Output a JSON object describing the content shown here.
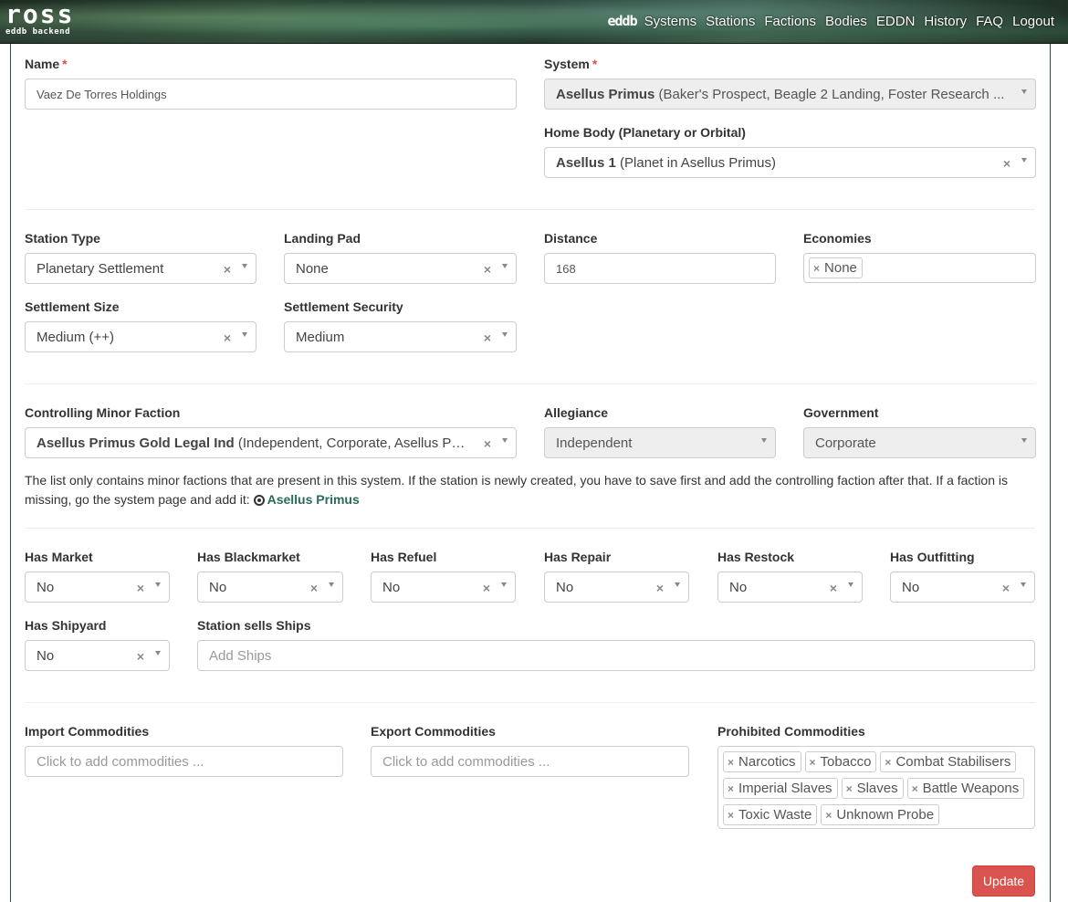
{
  "logo": {
    "big": "ross",
    "small": "eddb backend"
  },
  "nav": {
    "brand": "eddb",
    "items": [
      "Systems",
      "Stations",
      "Factions",
      "Bodies",
      "EDDN",
      "History",
      "FAQ",
      "Logout"
    ]
  },
  "form": {
    "name": {
      "label": "Name",
      "required": "*",
      "value": "Vaez De Torres Holdings"
    },
    "system": {
      "label": "System",
      "required": "*",
      "value_bold": "Asellus Primus",
      "value_rest": " (Baker's Prospect, Beagle 2 Landing, Foster Research ..."
    },
    "home_body": {
      "label": "Home Body (Planetary or Orbital)",
      "value_bold": "Asellus 1",
      "value_rest": " (Planet in Asellus Primus)"
    },
    "station_type": {
      "label": "Station Type",
      "value": "Planetary Settlement"
    },
    "landing_pad": {
      "label": "Landing Pad",
      "value": "None"
    },
    "distance": {
      "label": "Distance",
      "value": "168"
    },
    "economies": {
      "label": "Economies",
      "tags": [
        "None"
      ]
    },
    "settlement_size": {
      "label": "Settlement Size",
      "value": "Medium (++)"
    },
    "settlement_security": {
      "label": "Settlement Security",
      "value": "Medium"
    },
    "controlling_faction": {
      "label": "Controlling Minor Faction",
      "value_bold": "Asellus Primus Gold Legal Ind",
      "value_rest": " (Independent, Corporate, Asellus Pri..."
    },
    "allegiance": {
      "label": "Allegiance",
      "value": "Independent"
    },
    "government": {
      "label": "Government",
      "value": "Corporate"
    },
    "help": {
      "text": "The list only contains minor factions that are present in this system. If the station is newly created, you have to save first and add the controlling faction after that. If a faction is missing, go the system page and add it:",
      "link": "Asellus Primus"
    },
    "has_market": {
      "label": "Has Market",
      "value": "No"
    },
    "has_blackmarket": {
      "label": "Has Blackmarket",
      "value": "No"
    },
    "has_refuel": {
      "label": "Has Refuel",
      "value": "No"
    },
    "has_repair": {
      "label": "Has Repair",
      "value": "No"
    },
    "has_restock": {
      "label": "Has Restock",
      "value": "No"
    },
    "has_outfitting": {
      "label": "Has Outfitting",
      "value": "No"
    },
    "has_shipyard": {
      "label": "Has Shipyard",
      "value": "No"
    },
    "station_ships": {
      "label": "Station sells Ships",
      "placeholder": "Add Ships"
    },
    "import_commodities": {
      "label": "Import Commodities",
      "placeholder": "Click to add commodities ..."
    },
    "export_commodities": {
      "label": "Export Commodities",
      "placeholder": "Click to add commodities ..."
    },
    "prohibited": {
      "label": "Prohibited Commodities",
      "tags": [
        "Narcotics",
        "Tobacco",
        "Combat Stabilisers",
        "Imperial Slaves",
        "Slaves",
        "Battle Weapons",
        "Toxic Waste",
        "Unknown Probe"
      ]
    },
    "update_label": "Update"
  },
  "colors": {
    "accent": "#2a6b5a",
    "danger": "#d9534f"
  }
}
